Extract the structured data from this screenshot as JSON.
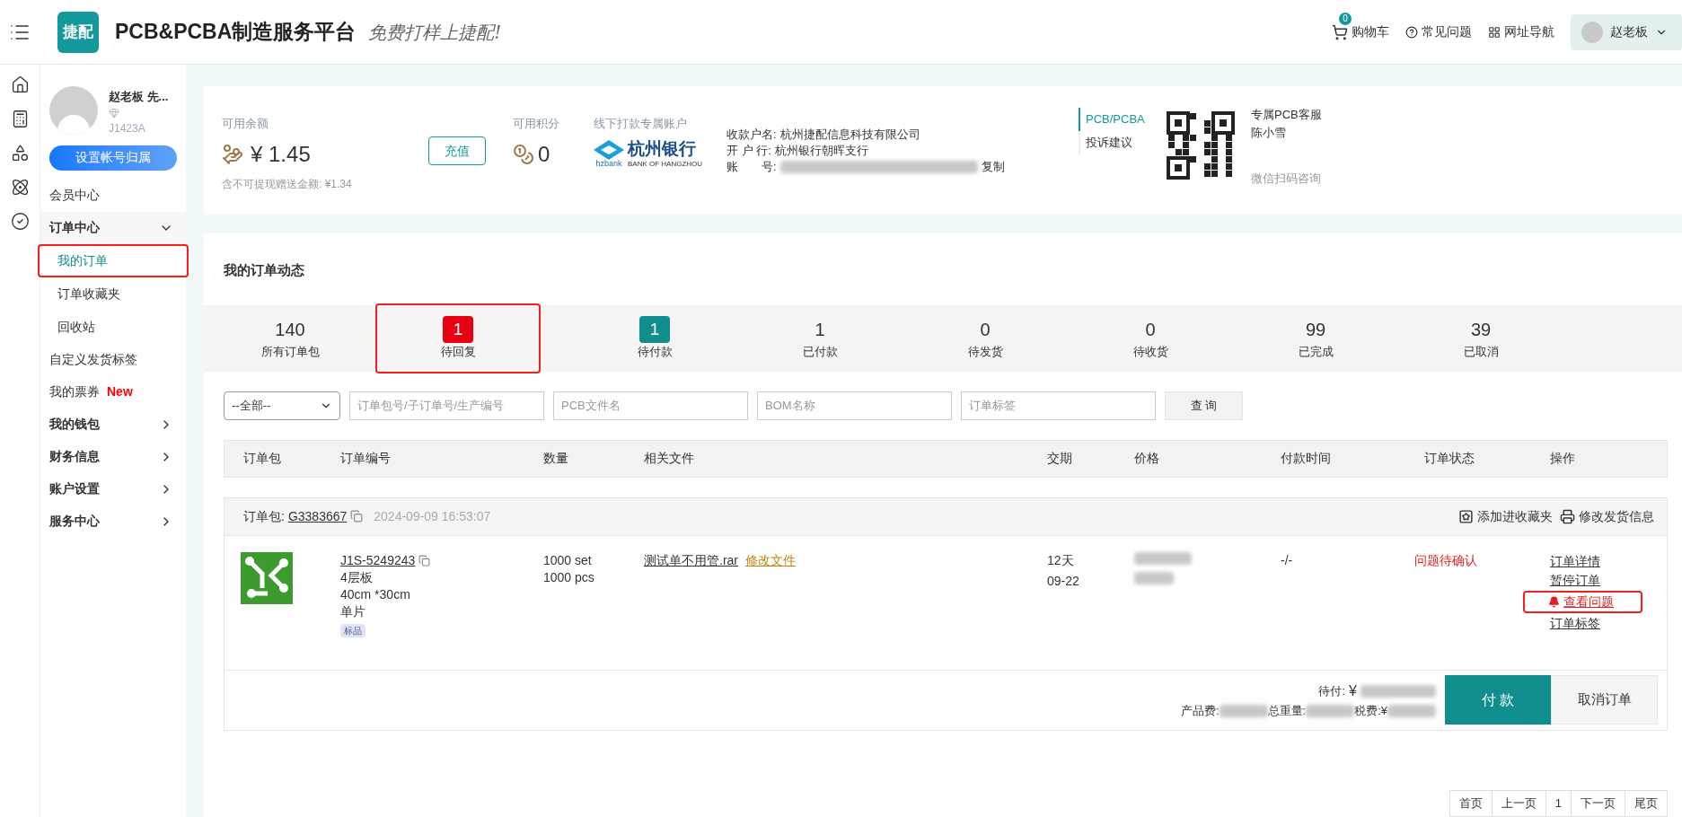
{
  "header": {
    "logo": "捷配",
    "title": "PCB&PCBA制造服务平台",
    "slogan": "免费打样上捷配!",
    "cart": {
      "label": "购物车",
      "badge": "0"
    },
    "links": [
      {
        "kind": "help",
        "label": "常见问题"
      },
      {
        "kind": "sitemap",
        "label": "网址导航"
      }
    ],
    "user": "赵老板"
  },
  "sidebar": {
    "profile": {
      "name": "赵老板 先...",
      "id": "J1423A"
    },
    "account_button": "设置帐号归属",
    "nav": [
      {
        "kind": "link",
        "label": "会员中心"
      },
      {
        "kind": "group",
        "label": "订单中心",
        "expanded": true,
        "children": [
          {
            "label": "我的订单",
            "selected": true,
            "highlighted": true
          },
          {
            "label": "订单收藏夹",
            "selected": false,
            "highlighted": false
          },
          {
            "label": "回收站",
            "selected": false,
            "highlighted": false
          }
        ]
      },
      {
        "kind": "link",
        "label": "自定义发货标签"
      },
      {
        "kind": "link",
        "label": "我的票券",
        "badge": "New"
      },
      {
        "kind": "group",
        "label": "我的钱包",
        "expanded": false
      },
      {
        "kind": "group",
        "label": "财务信息",
        "expanded": false
      },
      {
        "kind": "group",
        "label": "账户设置",
        "expanded": false
      },
      {
        "kind": "group",
        "label": "服务中心",
        "expanded": false
      }
    ]
  },
  "account": {
    "balance_label": "可用余额",
    "balance": "¥ 1.45",
    "balance_note": "含不可提现赠送金额: ¥1.34",
    "recharge": "充值",
    "points_label": "可用积分",
    "points": "0",
    "bank_label": "线下打款专属账户",
    "bank_logo": {
      "name": "杭州银行",
      "short": "hzbank",
      "english": "BANK OF HANGZHOU"
    },
    "bank_rows": [
      {
        "label": "收款户名:",
        "value": "杭州捷配信息科技有限公司",
        "masked": false
      },
      {
        "label": "开 户 行:",
        "value": "杭州银行朝晖支行",
        "masked": false
      },
      {
        "label": "账　　号:",
        "masked": true,
        "action": "复制"
      }
    ],
    "side_tabs": [
      {
        "label": "PCB/PCBA",
        "selected": true
      },
      {
        "label": "投诉建议",
        "selected": false
      }
    ],
    "service": {
      "title": "专属PCB客服",
      "name": "陈小雪",
      "hint": "微信扫码咨询"
    }
  },
  "orders": {
    "title": "我的订单动态",
    "stats": [
      {
        "count": "140",
        "label": "所有订单包",
        "highlighted": false
      },
      {
        "count": "1",
        "label": "待回复",
        "color": "#e60012",
        "highlighted": true
      },
      {
        "count": "1",
        "label": "待付款",
        "color": "#108e8e",
        "highlighted": false
      },
      {
        "count": "1",
        "label": "已付款",
        "highlighted": false
      },
      {
        "count": "0",
        "label": "待发货",
        "highlighted": false
      },
      {
        "count": "0",
        "label": "待收货",
        "highlighted": false
      },
      {
        "count": "99",
        "label": "已完成",
        "highlighted": false
      },
      {
        "count": "39",
        "label": "已取消",
        "highlighted": false
      }
    ],
    "filters": {
      "select": "--全部--",
      "placeholders": [
        "订单包号/子订单号/生产编号",
        "PCB文件名",
        "BOM名称",
        "订单标签"
      ],
      "button": "查 询"
    },
    "columns": [
      "订单包",
      "订单编号",
      "数量",
      "相关文件",
      "交期",
      "价格",
      "付款时间",
      "订单状态",
      "操作"
    ],
    "package": {
      "label": "订单包:",
      "id": "G3383667",
      "time": "2024-09-09 16:53:07",
      "actions": [
        {
          "kind": "favorite",
          "label": "添加进收藏夹"
        },
        {
          "kind": "print",
          "label": "修改发货信息"
        }
      ],
      "item": {
        "id": "J1S-5249243",
        "specs": [
          "4层板",
          "40cm *30cm",
          "单片"
        ],
        "tag": "标品",
        "quantity": [
          "1000 set",
          "1000 pcs"
        ],
        "file": "测试单不用管.rar",
        "file_action": "修改文件",
        "delivery": [
          "12天",
          "09-22"
        ],
        "price_masked": true,
        "pay_time": "-/-",
        "status": "问题待确认",
        "operations": [
          {
            "kind": "link",
            "label": "订单详情",
            "highlighted": false
          },
          {
            "kind": "link",
            "label": "暂停订单",
            "highlighted": false
          },
          {
            "kind": "alert",
            "label": "查看问题",
            "highlighted": true
          },
          {
            "kind": "link",
            "label": "订单标签",
            "highlighted": false
          }
        ]
      },
      "due_label": "待付:",
      "currency": "¥",
      "fee_labels": [
        "产品费:",
        "总重量:",
        "税费:¥"
      ],
      "pay": "付 款",
      "cancel": "取消订单"
    },
    "pagination": [
      "首页",
      "上一页",
      "1",
      "下一页",
      "尾页"
    ]
  }
}
